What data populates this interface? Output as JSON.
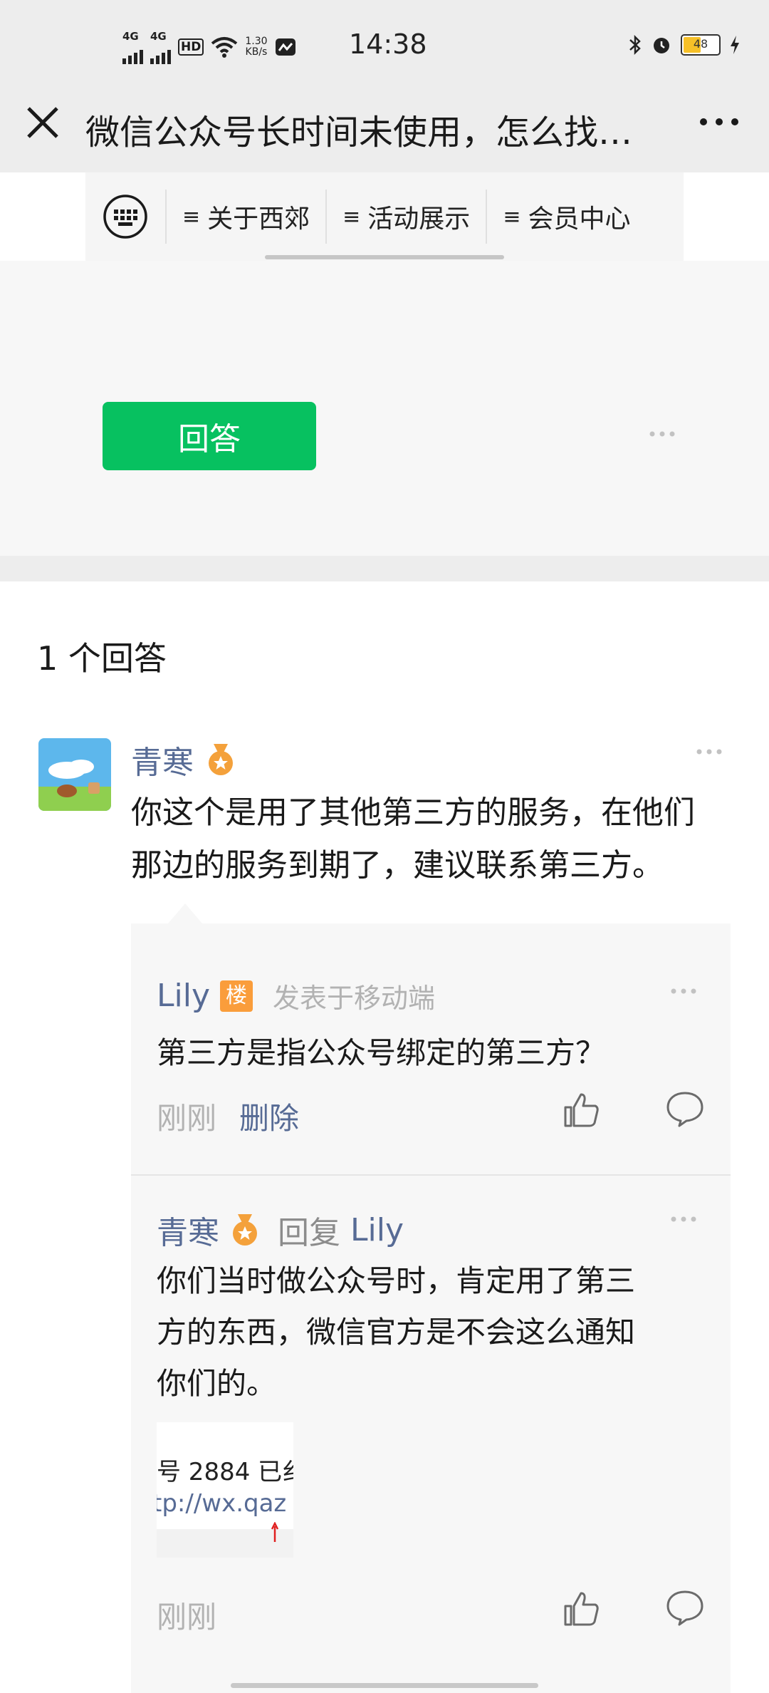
{
  "status_bar": {
    "network_1": "4G",
    "network_2": "4G",
    "hd": "HD",
    "speed_value": "1.30",
    "speed_unit": "KB/s",
    "time": "14:38",
    "battery": "48"
  },
  "title_bar": {
    "title": "微信公众号长时间未使用，怎么找…"
  },
  "menu": {
    "items": [
      "关于西郊",
      "活动展示",
      "会员中心"
    ]
  },
  "question": {
    "answer_button": "回答"
  },
  "answers": {
    "count_label": "1 个回答",
    "items": [
      {
        "author": "青寒",
        "text_line1": "你这个是用了其他第三方的服务，在他们",
        "text_line2": "那边的服务到期了，建议联系第三方。"
      }
    ]
  },
  "comments": [
    {
      "author": "Lily",
      "badge": "楼",
      "source": "发表于移动端",
      "text": "第三方是指公众号绑定的第三方？",
      "time": "刚刚",
      "delete_label": "删除"
    },
    {
      "author": "青寒",
      "reply_word": "回复",
      "reply_to": "Lily",
      "text_line1": "你们当时做公众号时，肯定用了第三",
      "text_line2": "方的东西，微信官方是不会这么通知",
      "text_line3": "你们的。",
      "image_line1": "号 2884 已纟",
      "image_line2": "tp://wx.qaz",
      "time": "刚刚"
    }
  ],
  "colors": {
    "accent_green": "#07c160",
    "link_blue": "#576b95",
    "badge_orange": "#fa9d3b",
    "background_grey": "#ededed"
  }
}
